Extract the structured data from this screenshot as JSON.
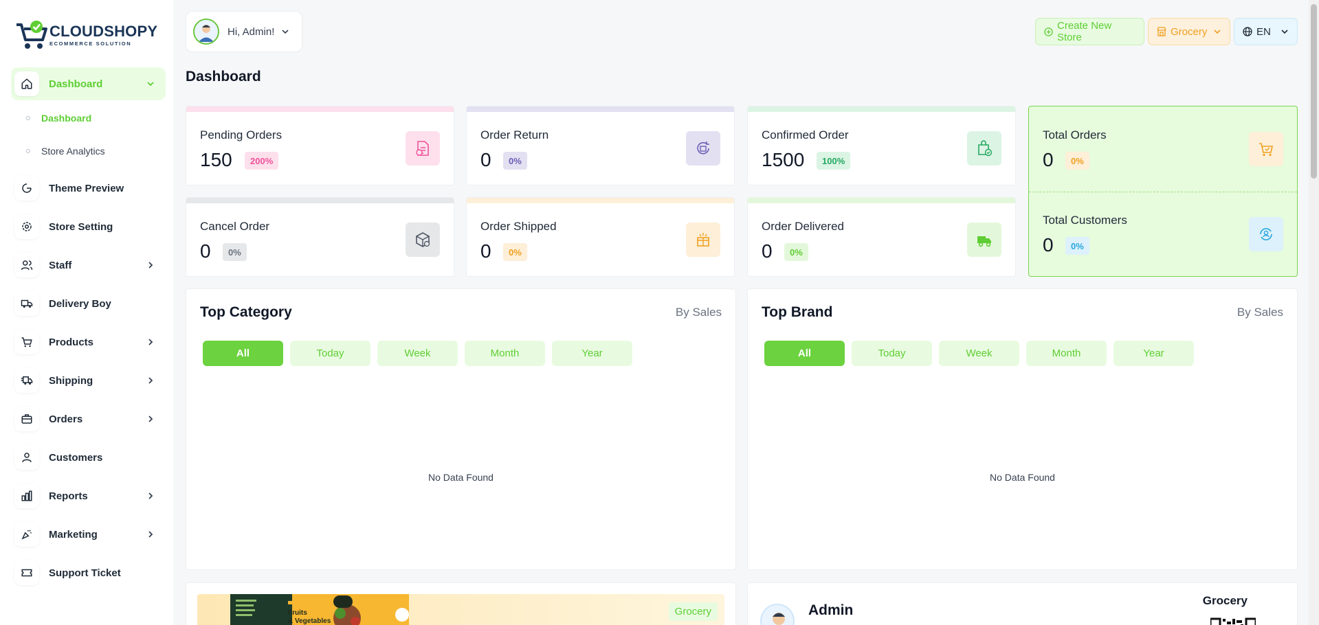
{
  "logo": {
    "title": "CLOUDSHOPY",
    "subtitle": "ECOMMERCE SOLUTION"
  },
  "sidebar": {
    "items": [
      {
        "label": "Dashboard",
        "icon": "home-icon",
        "active": true,
        "expandable": true
      },
      {
        "label": "Theme Preview",
        "icon": "theme-icon"
      },
      {
        "label": "Store Setting",
        "icon": "gear-icon"
      },
      {
        "label": "Staff",
        "icon": "users-icon",
        "expandable": true
      },
      {
        "label": "Delivery Boy",
        "icon": "truck-icon"
      },
      {
        "label": "Products",
        "icon": "cart-icon",
        "expandable": true
      },
      {
        "label": "Shipping",
        "icon": "shipping-icon",
        "expandable": true
      },
      {
        "label": "Orders",
        "icon": "briefcase-icon",
        "expandable": true
      },
      {
        "label": "Customers",
        "icon": "user-icon"
      },
      {
        "label": "Reports",
        "icon": "chart-icon",
        "expandable": true
      },
      {
        "label": "Marketing",
        "icon": "megaphone-icon",
        "expandable": true
      },
      {
        "label": "Support Ticket",
        "icon": "ticket-icon"
      }
    ],
    "subitems": [
      {
        "label": "Dashboard",
        "active": true
      },
      {
        "label": "Store Analytics"
      }
    ]
  },
  "header": {
    "greeting": "Hi, Admin!",
    "create_store": "Create New Store",
    "store_select": "Grocery",
    "language": "EN"
  },
  "page": {
    "title": "Dashboard"
  },
  "stats": [
    {
      "label": "Pending Orders",
      "value": "150",
      "badge": "200%",
      "color": "#f0519a"
    },
    {
      "label": "Order Return",
      "value": "0",
      "badge": "0%",
      "color": "#6b5fb5"
    },
    {
      "label": "Confirmed Order",
      "value": "1500",
      "badge": "100%",
      "color": "#22a861"
    },
    {
      "label": "Cancel Order",
      "value": "0",
      "badge": "0%",
      "color": "#6b7280"
    },
    {
      "label": "Order Shipped",
      "value": "0",
      "badge": "0%",
      "color": "#f0a020"
    },
    {
      "label": "Order Delivered",
      "value": "0",
      "badge": "0%",
      "color": "#5fce34"
    }
  ],
  "totals": {
    "orders": {
      "label": "Total Orders",
      "value": "0",
      "badge": "0%"
    },
    "customers": {
      "label": "Total Customers",
      "value": "0",
      "badge": "0%"
    }
  },
  "top_category": {
    "title": "Top Category",
    "subtitle": "By Sales",
    "tabs": [
      "All",
      "Today",
      "Week",
      "Month",
      "Year"
    ],
    "empty": "No Data Found"
  },
  "top_brand": {
    "title": "Top Brand",
    "subtitle": "By Sales",
    "tabs": [
      "All",
      "Today",
      "Week",
      "Month",
      "Year"
    ],
    "empty": "No Data Found"
  },
  "store_banner": {
    "tag": "Grocery",
    "headline": "Fruits & Vegetables"
  },
  "profile": {
    "name": "Admin",
    "store": "Grocery"
  },
  "colors": {
    "accent": "#5fce34",
    "accent_bg": "#e8fbe0",
    "brand": "#1b3557"
  }
}
